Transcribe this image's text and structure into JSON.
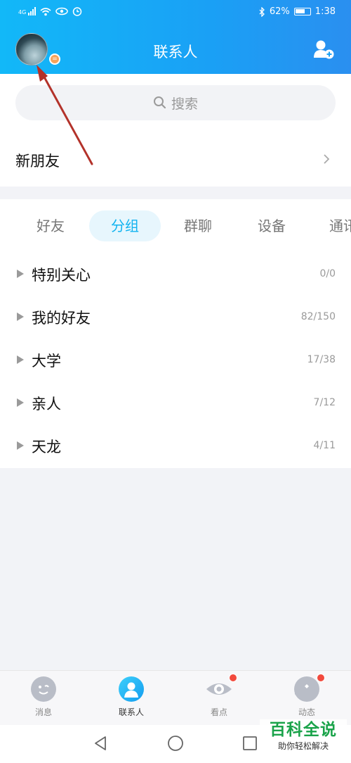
{
  "status_bar": {
    "signal_text": "4G",
    "battery_percent": "62%",
    "time": "1:38"
  },
  "header": {
    "title": "联系人",
    "avatar_icon": "avatar-icon",
    "badge_glyph": "=",
    "add_friend_icon": "add-friend-icon"
  },
  "search": {
    "placeholder": "搜索",
    "icon": "search-icon"
  },
  "new_friends": {
    "label": "新朋友"
  },
  "tabs": [
    {
      "label": "好友",
      "active": false
    },
    {
      "label": "分组",
      "active": true
    },
    {
      "label": "群聊",
      "active": false
    },
    {
      "label": "设备",
      "active": false
    },
    {
      "label": "通讯",
      "active": false
    }
  ],
  "groups": [
    {
      "name": "特别关心",
      "count": "0/0"
    },
    {
      "name": "我的好友",
      "count": "82/150"
    },
    {
      "name": "大学",
      "count": "17/38"
    },
    {
      "name": "亲人",
      "count": "7/12"
    },
    {
      "name": "天龙",
      "count": "4/11"
    }
  ],
  "bottom_nav": [
    {
      "label": "消息",
      "icon": "message-icon",
      "active": false,
      "dot": false
    },
    {
      "label": "联系人",
      "icon": "contacts-icon",
      "active": true,
      "dot": false
    },
    {
      "label": "看点",
      "icon": "eye-icon",
      "active": false,
      "dot": true
    },
    {
      "label": "动态",
      "icon": "planet-icon",
      "active": false,
      "dot": true
    }
  ],
  "watermark": {
    "title": "百科全说",
    "subtitle": "助你轻松解决"
  },
  "colors": {
    "header_start": "#12b8f8",
    "header_end": "#2a8ff0",
    "accent": "#12b3f0",
    "annotation_arrow": "#b3322a",
    "notification_dot": "#f24a3d"
  }
}
